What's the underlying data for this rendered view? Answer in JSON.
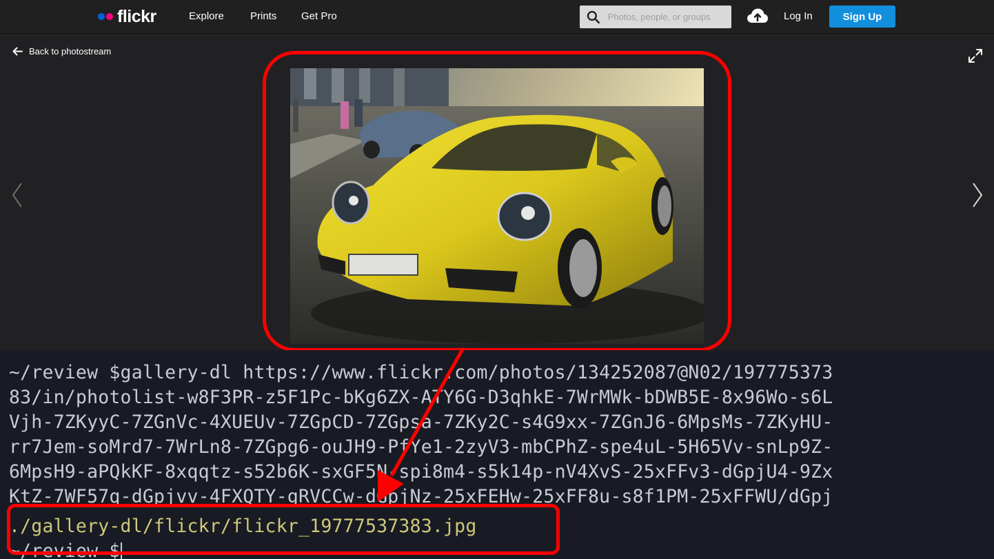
{
  "nav": {
    "logo": "flickr",
    "links": [
      "Explore",
      "Prints",
      "Get Pro"
    ],
    "search_placeholder": "Photos, people, or groups",
    "login": "Log In",
    "signup": "Sign Up"
  },
  "viewer": {
    "back_label": "Back to photostream"
  },
  "terminal": {
    "lines": [
      "~/review $gallery-dl https://www.flickr.com/photos/134252087@N02/197775373",
      "83/in/photolist-w8F3PR-z5F1Pc-bKg6ZX-ATY6G-D3qhkE-7WrMWk-bDWB5E-8x96Wo-s6L",
      "Vjh-7ZKyyC-7ZGnVc-4XUEUv-7ZGpCD-7ZGpsa-7ZKy2C-s4G9xx-7ZGnJ6-6MpsMs-7ZKyHU-",
      "rr7Jem-soMrd7-7WrLn8-7ZGpg6-ouJH9-PfYe1-2zyV3-mbCPhZ-spe4uL-5H65Vv-snLp9Z-",
      "6MpsH9-aPQkKF-8xqqtz-s52b6K-sxGF5N-spi8m4-s5k14p-nV4XvS-25xFFv3-dGpjU4-9Zx",
      "KtZ-7WF57q-dGpjvv-4FXQTY-gRVCCw-dGpjNz-25xFEHw-25xFF8u-s8f1PM-25xFFWU/dGpj",
      "./gallery-dl/flickr/flickr_19777537383.jpg",
      "~/review $"
    ]
  },
  "colors": {
    "highlight": "#ff0000",
    "signup_bg": "#128fdc",
    "car": "#e3cf1e"
  }
}
